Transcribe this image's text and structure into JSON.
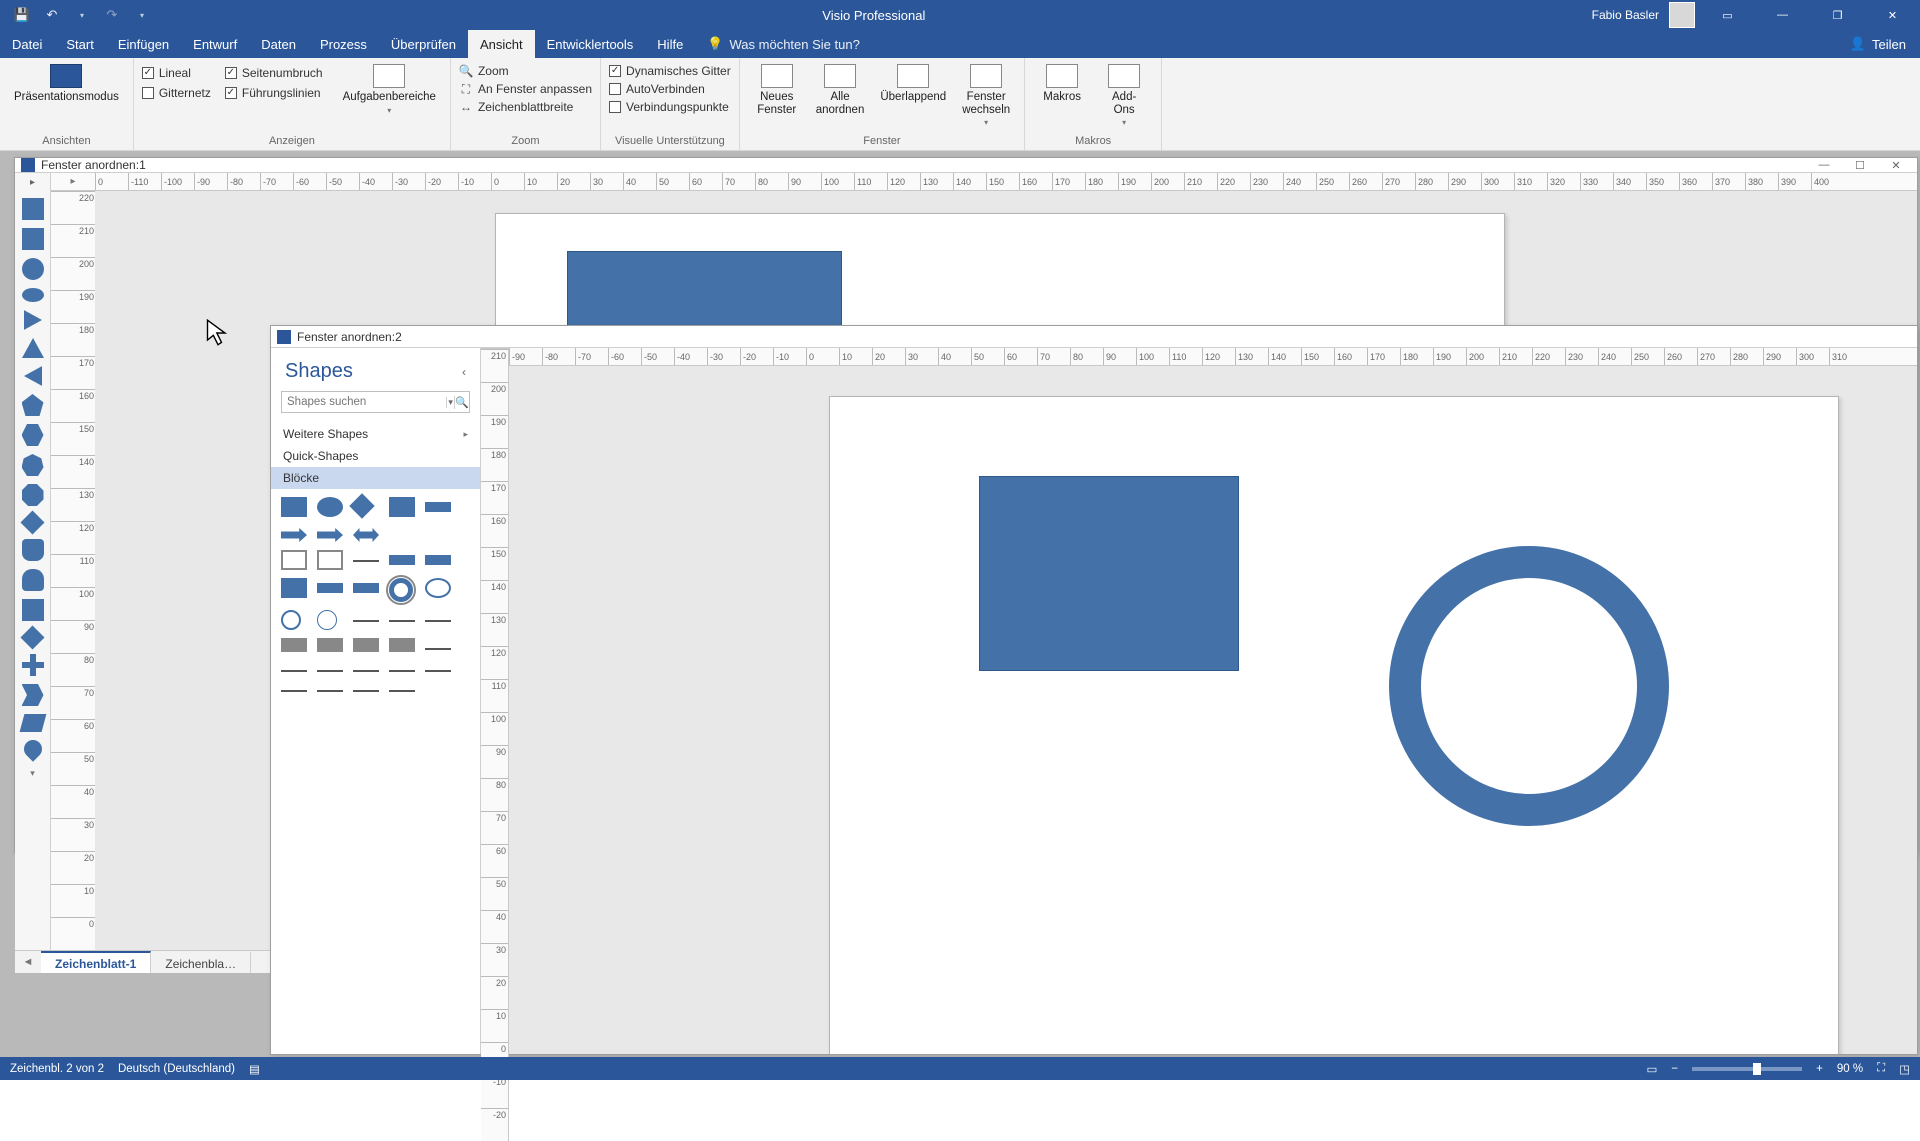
{
  "app": {
    "title": "Visio Professional",
    "user": "Fabio Basler",
    "share": "Teilen"
  },
  "menu": {
    "items": [
      "Datei",
      "Start",
      "Einfügen",
      "Entwurf",
      "Daten",
      "Prozess",
      "Überprüfen",
      "Ansicht",
      "Entwicklertools",
      "Hilfe"
    ],
    "active": "Ansicht",
    "tell_me": "Was möchten Sie tun?"
  },
  "ribbon": {
    "g_ansichten": {
      "label": "Ansichten",
      "presentation": "Präsentationsmodus"
    },
    "g_anzeigen": {
      "label": "Anzeigen",
      "lineal": "Lineal",
      "gitternetz": "Gitternetz",
      "seitenumbruch": "Seitenumbruch",
      "fuehrungslinien": "Führungslinien",
      "aufgaben": "Aufgabenbereiche",
      "lineal_checked": true,
      "gitternetz_checked": false,
      "seitenumbruch_checked": true,
      "fuehrungslinien_checked": true
    },
    "g_zoom": {
      "label": "Zoom",
      "zoom": "Zoom",
      "fit": "An Fenster anpassen",
      "pagewidth": "Zeichenblattbreite"
    },
    "g_visuell": {
      "label": "Visuelle Unterstützung",
      "dyn": "Dynamisches Gitter",
      "auto": "AutoVerbinden",
      "conn": "Verbindungspunkte",
      "dyn_checked": true,
      "auto_checked": false,
      "conn_checked": false
    },
    "g_fenster": {
      "label": "Fenster",
      "neues": "Neues\nFenster",
      "alle": "Alle\nanordnen",
      "cascade": "Überlappend",
      "switch": "Fenster\nwechseln"
    },
    "g_makros": {
      "label": "Makros",
      "makros": "Makros",
      "addons": "Add-\nOns"
    }
  },
  "win1": {
    "title": "Fenster anordnen:1"
  },
  "win2": {
    "title": "Fenster anordnen:2"
  },
  "shapes_panel": {
    "title": "Shapes",
    "search_placeholder": "Shapes suchen",
    "weitere": "Weitere Shapes",
    "quick": "Quick-Shapes",
    "bloecke": "Blöcke"
  },
  "ruler_h1": [
    "0",
    "-110",
    "-100",
    "-90",
    "-80",
    "-70",
    "-60",
    "-50",
    "-40",
    "-30",
    "-20",
    "-10",
    "0",
    "10",
    "20",
    "30",
    "40",
    "50",
    "60",
    "70",
    "80",
    "90",
    "100",
    "110",
    "120",
    "130",
    "140",
    "150",
    "160",
    "170",
    "180",
    "190",
    "200",
    "210",
    "220",
    "230",
    "240",
    "250",
    "260",
    "270",
    "280",
    "290",
    "300",
    "310",
    "320",
    "330",
    "340",
    "350",
    "360",
    "370",
    "380",
    "390",
    "400"
  ],
  "ruler_v1": [
    "220",
    "210",
    "200",
    "190",
    "180",
    "170",
    "160",
    "150",
    "140",
    "130",
    "120",
    "110",
    "100",
    "90",
    "80",
    "70",
    "60",
    "50",
    "40",
    "30",
    "20",
    "10",
    "0"
  ],
  "ruler_h2": [
    "-90",
    "-80",
    "-70",
    "-60",
    "-50",
    "-40",
    "-30",
    "-20",
    "-10",
    "0",
    "10",
    "20",
    "30",
    "40",
    "50",
    "60",
    "70",
    "80",
    "90",
    "100",
    "110",
    "120",
    "130",
    "140",
    "150",
    "160",
    "170",
    "180",
    "190",
    "200",
    "210",
    "220",
    "230",
    "240",
    "250",
    "260",
    "270",
    "280",
    "290",
    "300",
    "310"
  ],
  "ruler_v2": [
    "210",
    "200",
    "190",
    "180",
    "170",
    "160",
    "150",
    "140",
    "130",
    "120",
    "110",
    "100",
    "90",
    "80",
    "70",
    "60",
    "50",
    "40",
    "30",
    "20",
    "10",
    "0",
    "-10",
    "-20"
  ],
  "sheets": {
    "active": "Zeichenblatt-1",
    "other": "Zeichenbla…"
  },
  "status": {
    "page": "Zeichenbl. 2 von 2",
    "lang": "Deutsch (Deutschland)",
    "zoom": "90 %"
  },
  "colors": {
    "visio_blue": "#2b579a",
    "shape_fill": "#4472a8"
  }
}
